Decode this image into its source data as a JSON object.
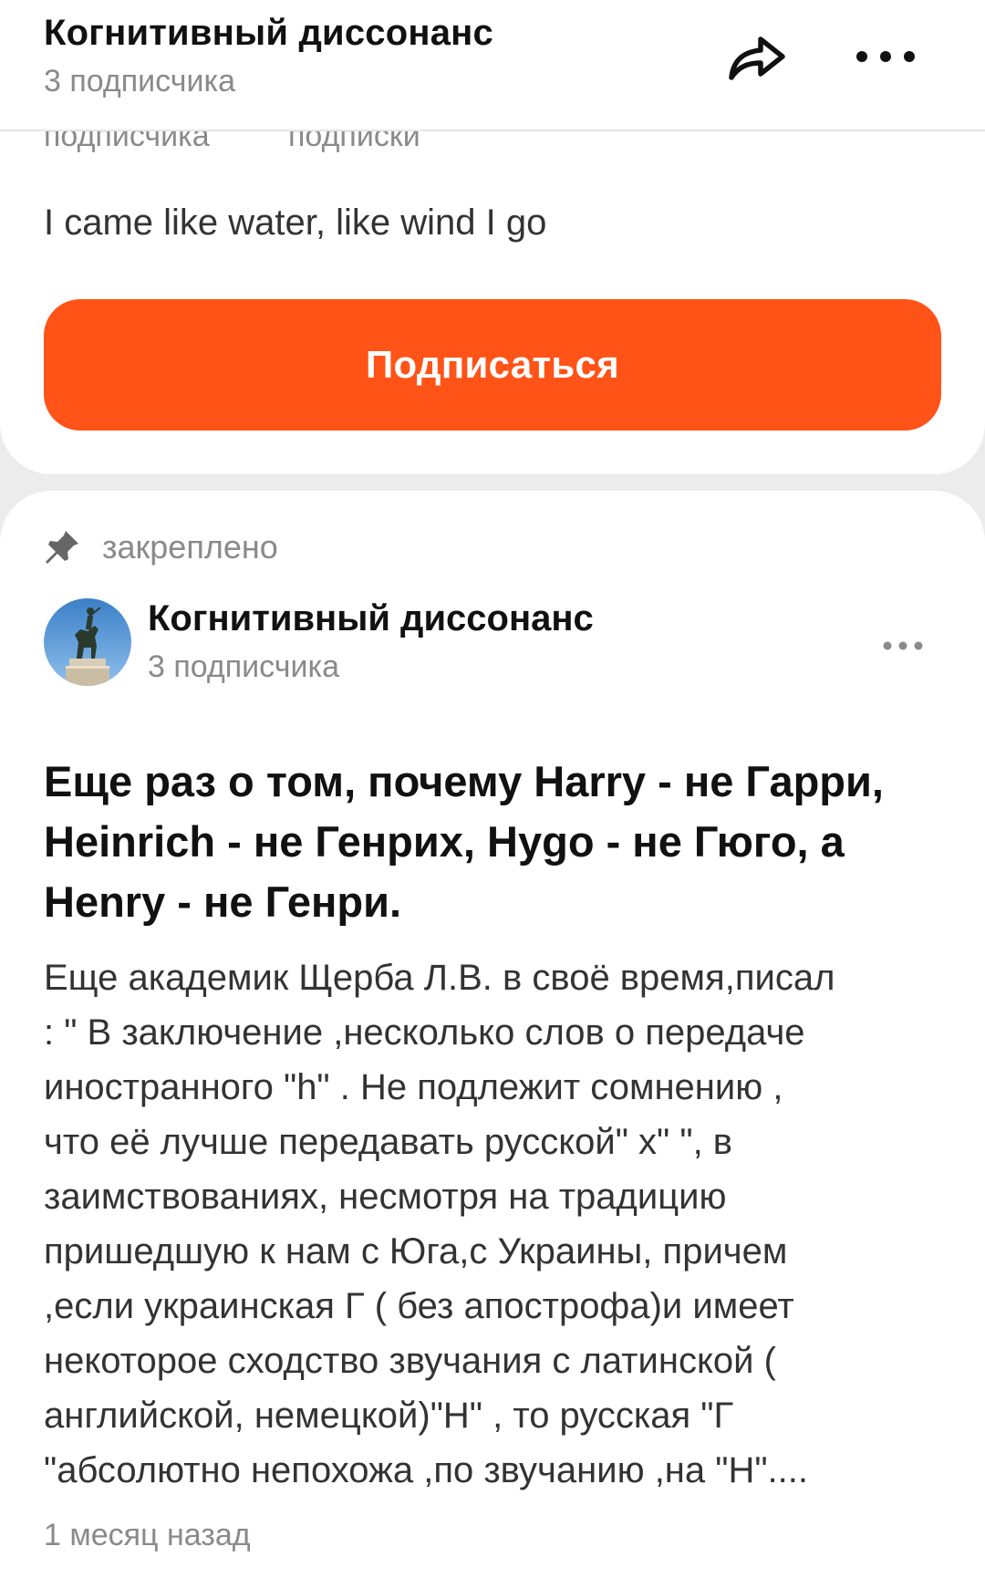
{
  "header": {
    "title": "Когнитивный диссонанс",
    "subtitle": "3 подписчика",
    "share_icon": "share-arrow-icon",
    "more_icon": "more-horizontal-icon"
  },
  "profile": {
    "stats_labels": [
      "подписчика",
      "подписки"
    ],
    "bio": "I came like water, like wind I go",
    "subscribe_label": "Подписаться",
    "accent_color": "#ff5317"
  },
  "post": {
    "pinned_icon": "pin-icon",
    "pinned_label": "закреплено",
    "author_name": "Когнитивный диссонанс",
    "author_subtitle": "3 подписчика",
    "avatar": "equestrian-statue-avatar",
    "more_icon": "more-horizontal-icon",
    "title": "Еще раз о том, почему Harry - не Гарри, Heinrich - не Генрих, Hygo - не Гюго, а Henry - не Генри.",
    "body_lines": [
      "Еще академик Щерба Л.В. в своё время,писал",
      ": \" В заключение ,несколько слов о передаче",
      "иностранного \"h\" . Не подлежит сомнению ,",
      "что её лучше передавать русской\" х\" \", в",
      "заимствованиях, несмотря на традицию",
      "пришедшую к нам с Юга,с Украины, причем",
      ",если украинская Г ( без апострофа)и имеет",
      "некоторое сходство звучания с латинской (",
      "английской, немецкой)\"Н\" , то русская \"Г",
      "\"абсолютно непохожа ,по звучанию ,на \"Н\"...."
    ],
    "time": "1 месяц назад"
  }
}
